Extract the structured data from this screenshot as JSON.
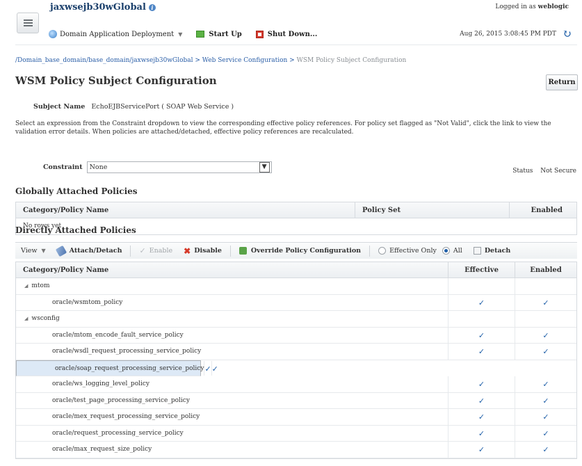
{
  "header": {
    "title": "jaxwsejb30wGlobal",
    "logged_in_prefix": "Logged in as",
    "user": "weblogic",
    "menu": [
      {
        "label": "Domain Application Deployment",
        "icon": "globe-icon"
      },
      {
        "label": "Start Up",
        "icon": "start-icon"
      },
      {
        "label": "Shut Down...",
        "icon": "stop-icon"
      }
    ],
    "datetime": "Aug 26, 2015 3:08:45 PM PDT"
  },
  "breadcrumb": {
    "path": "/Domain_base_domain/base_domain/jaxwsejb30wGlobal > Web Service Configuration >",
    "current": "WSM Policy Subject Configuration"
  },
  "page": {
    "title": "WSM Policy Subject Configuration",
    "return_label": "Return",
    "subject_label": "Subject Name",
    "subject_value": "EchoEJBServicePort ( SOAP Web Service )",
    "description": "Select an expression from the Constraint dropdown to view the corresponding effective policy references. For policy set flagged as \"Not Valid\", click the link to view the validation error details. When policies are attached/detached, effective policy references are recalculated.",
    "constraint_label": "Constraint",
    "constraint_value": "None",
    "status_label": "Status",
    "status_value": "Not Secure"
  },
  "global": {
    "heading": "Globally Attached Policies",
    "columns": [
      "Category/Policy Name",
      "Policy Set",
      "Enabled"
    ],
    "empty": "No rows yet"
  },
  "direct": {
    "heading": "Directly Attached Policies",
    "toolbar": {
      "view": "View",
      "attach": "Attach/Detach",
      "enable": "Enable",
      "disable": "Disable",
      "override": "Override Policy Configuration",
      "effective_only": "Effective Only",
      "all": "All",
      "detach": "Detach"
    },
    "columns": [
      "Category/Policy Name",
      "Effective",
      "Enabled"
    ],
    "check": "✓",
    "rows": [
      {
        "name": "mtom",
        "group": true
      },
      {
        "name": "oracle/wsmtom_policy"
      },
      {
        "name": "wsconfig",
        "group": true
      },
      {
        "name": "oracle/mtom_encode_fault_service_policy"
      },
      {
        "name": "oracle/wsdl_request_processing_service_policy"
      },
      {
        "name": "oracle/soap_request_processing_service_policy",
        "selected": true
      },
      {
        "name": "oracle/ws_logging_level_policy"
      },
      {
        "name": "oracle/test_page_processing_service_policy"
      },
      {
        "name": "oracle/mex_request_processing_service_policy"
      },
      {
        "name": "oracle/request_processing_service_policy"
      },
      {
        "name": "oracle/max_request_size_policy"
      }
    ]
  }
}
